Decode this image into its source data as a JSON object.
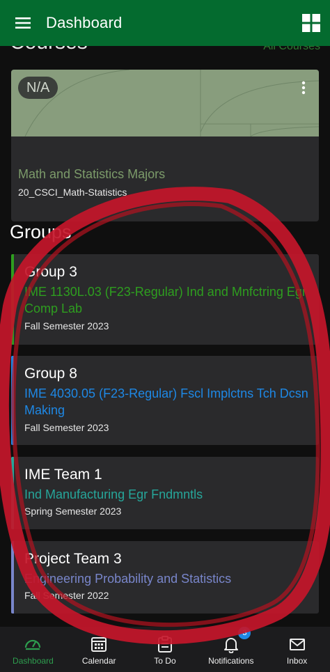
{
  "app_bar": {
    "title": "Dashboard",
    "menu_icon": "hamburger-menu-icon",
    "grid_icon": "grid-view-icon",
    "color": "#046b2f"
  },
  "courses": {
    "heading": "Courses",
    "all_link": "All Courses",
    "card": {
      "grade": "N/A",
      "name": "Math and Statistics Majors",
      "code": "20_CSCI_Math-Statistics",
      "hero_color": "#889d7d",
      "name_color": "#7c9b6a"
    }
  },
  "groups": {
    "heading": "Groups",
    "items": [
      {
        "name": "Group 3",
        "course": "IME 1130L.03 (F23-Regular) Ind and Mnfctring Egr Comp Lab",
        "term": "Fall Semester 2023",
        "color": "#2e9e1f"
      },
      {
        "name": "Group 8",
        "course": "IME 4030.05 (F23-Regular) Fscl Implctns Tch Dcsn Making",
        "term": "Fall Semester 2023",
        "color": "#1e88e5"
      },
      {
        "name": "IME Team 1",
        "course": "Ind Manufacturing Egr Fndmntls",
        "term": "Spring Semester 2023",
        "color": "#26a69a"
      },
      {
        "name": "Project Team 3",
        "course": "Engineering Probability and Statistics",
        "term": "Fall Semester 2022",
        "color": "#7986cb"
      }
    ]
  },
  "bottom_nav": {
    "items": [
      {
        "label": "Dashboard",
        "icon": "dashboard-gauge-icon",
        "active": true
      },
      {
        "label": "Calendar",
        "icon": "calendar-icon",
        "active": false
      },
      {
        "label": "To Do",
        "icon": "clipboard-icon",
        "active": false
      },
      {
        "label": "Notifications",
        "icon": "bell-icon",
        "active": false,
        "badge": "3"
      },
      {
        "label": "Inbox",
        "icon": "envelope-icon",
        "active": false
      }
    ]
  }
}
